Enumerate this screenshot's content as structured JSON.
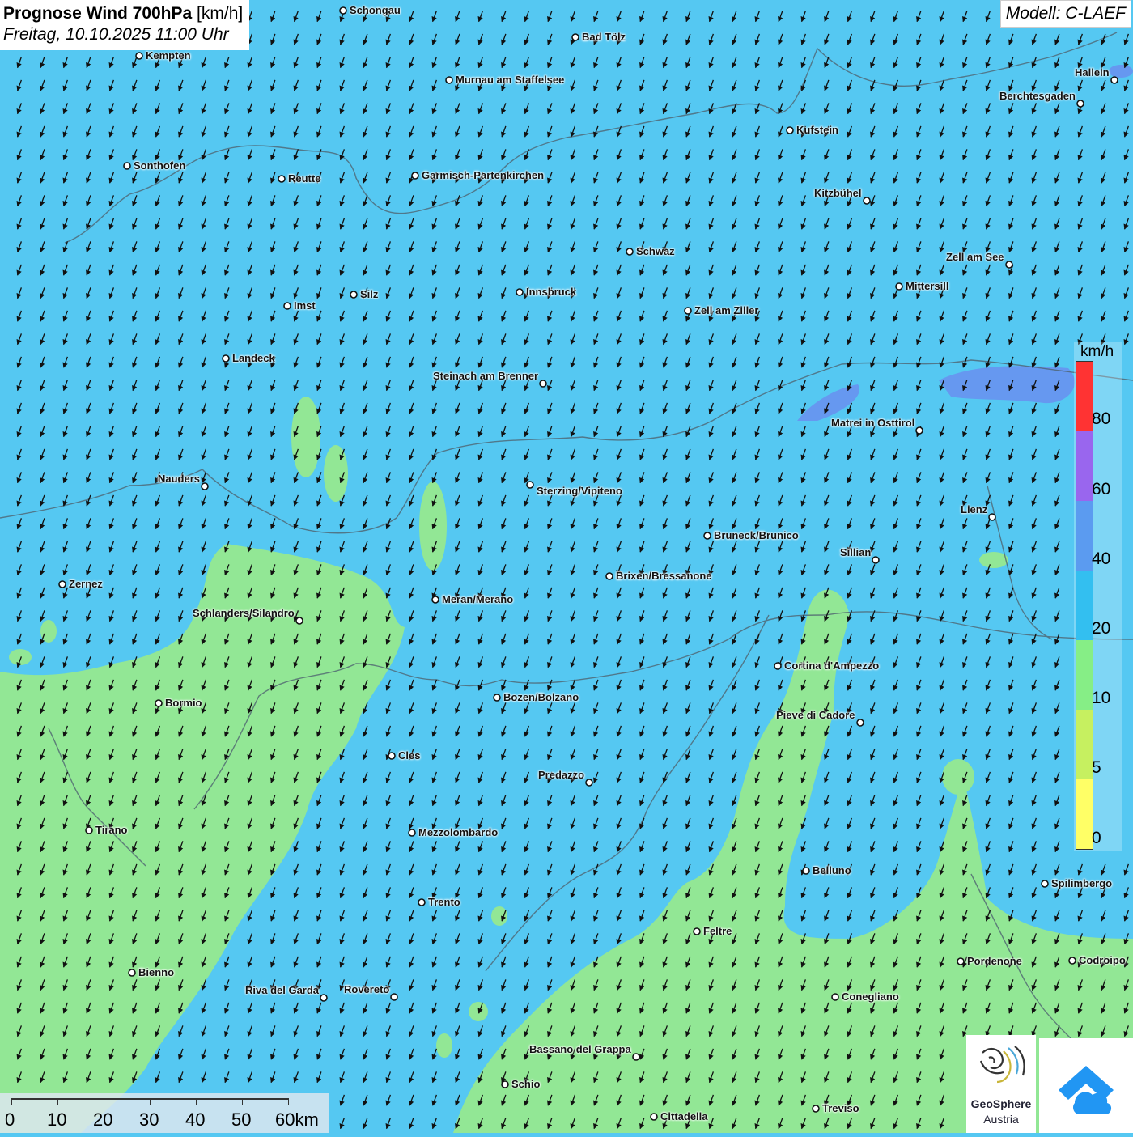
{
  "header": {
    "title_main": "Prognose Wind 700hPa",
    "title_unit": "[km/h]",
    "date": "Freitag, 10.10.2025 11:00 Uhr",
    "model": "Modell: C-LAEF"
  },
  "legend": {
    "unit": "km/h",
    "ticks": [
      "80",
      "60",
      "40",
      "20",
      "10",
      "5",
      "0"
    ],
    "colors": {
      "gt80": "#ff3333",
      "60_80": "#9966ee",
      "40_60": "#5b9bf0",
      "20_40": "#33bff0",
      "10_20": "#86ee86",
      "5_10": "#c6f060",
      "0_5": "#ffff66"
    }
  },
  "map_colors": {
    "background": "#55c8f2",
    "calm_zone": "#92e795",
    "strong_zone": "#6a8ff0",
    "border": "#566"
  },
  "wind_arrows": {
    "direction_deg_towards": 200,
    "description_text": ""
  },
  "cities": [
    {
      "name": "Schongau"
    },
    {
      "name": "Bad Tölz"
    },
    {
      "name": "Kempten"
    },
    {
      "name": "Hallein"
    },
    {
      "name": "Murnau am Staffelsee"
    },
    {
      "name": "Berchtesgaden"
    },
    {
      "name": "Kufstein"
    },
    {
      "name": "Sonthofen"
    },
    {
      "name": "Reutte"
    },
    {
      "name": "Garmisch-Partenkirchen"
    },
    {
      "name": "Kitzbühel"
    },
    {
      "name": "Schwaz"
    },
    {
      "name": "Zell am See"
    },
    {
      "name": "Innsbruck"
    },
    {
      "name": "Mittersill"
    },
    {
      "name": "Silz"
    },
    {
      "name": "Imst"
    },
    {
      "name": "Zell am Ziller"
    },
    {
      "name": "Landeck"
    },
    {
      "name": "Steinach am Brenner"
    },
    {
      "name": "Matrei in Osttirol"
    },
    {
      "name": "Nauders"
    },
    {
      "name": "Sterzing/Vipiteno"
    },
    {
      "name": "Lienz"
    },
    {
      "name": "Bruneck/Brunico"
    },
    {
      "name": "Sillian"
    },
    {
      "name": "Zernez"
    },
    {
      "name": "Brixen/Bressanone"
    },
    {
      "name": "Meran/Merano"
    },
    {
      "name": "Schlanders/Silandro"
    },
    {
      "name": "Cortina d'Ampezzo"
    },
    {
      "name": "Bozen/Bolzano"
    },
    {
      "name": "Bormio"
    },
    {
      "name": "Pieve di Cadore"
    },
    {
      "name": "Cles"
    },
    {
      "name": "Predazzo"
    },
    {
      "name": "Tirano"
    },
    {
      "name": "Mezzolombardo"
    },
    {
      "name": "Belluno"
    },
    {
      "name": "Spilimbergo"
    },
    {
      "name": "Trento"
    },
    {
      "name": "Feltre"
    },
    {
      "name": "Pordenone"
    },
    {
      "name": "Codroipo"
    },
    {
      "name": "Bienno"
    },
    {
      "name": "Riva del Garda"
    },
    {
      "name": "Rovereto"
    },
    {
      "name": "Conegliano"
    },
    {
      "name": "Bassano del Grappa"
    },
    {
      "name": "Schio"
    },
    {
      "name": "Treviso"
    },
    {
      "name": "Cittadella"
    }
  ],
  "scale": {
    "ticks": [
      "0",
      "10",
      "20",
      "30",
      "40",
      "50"
    ],
    "last": "60km"
  },
  "logo": {
    "line1": "GeoSphere",
    "line2": "Austria"
  }
}
